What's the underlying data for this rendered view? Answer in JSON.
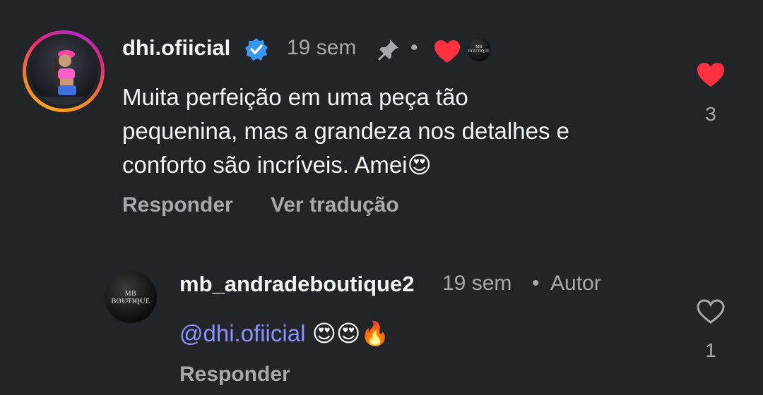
{
  "comment": {
    "username": "dhi.ofiicial",
    "time": "19 sem",
    "separator": "•",
    "text_line1": "Muita perfeição em uma peça tão",
    "text_line2": "pequenina, mas a grandeza nos detalhes e",
    "text_line3": "conforto são incríveis. Amei",
    "emoji": "😍",
    "reply_label": "Responder",
    "translate_label": "Ver tradução",
    "like_count": "3",
    "author_like_brand": "MB BOUTIQUE"
  },
  "reply": {
    "username": "mb_andradeboutique2",
    "time": "19 sem",
    "separator": "•",
    "author_label": "Autor",
    "mention": "@dhi.ofiicial",
    "emojis": "😍😍🔥",
    "reply_label": "Responder",
    "like_count": "1",
    "avatar_brand": "MB BOUTIQUE",
    "avatar_sub": "ANDRADE"
  },
  "colors": {
    "background": "#232428",
    "heart_red": "#ff3040",
    "verified_blue": "#3897f0",
    "mention": "#8b92ff",
    "muted": "#a8a9ae"
  }
}
